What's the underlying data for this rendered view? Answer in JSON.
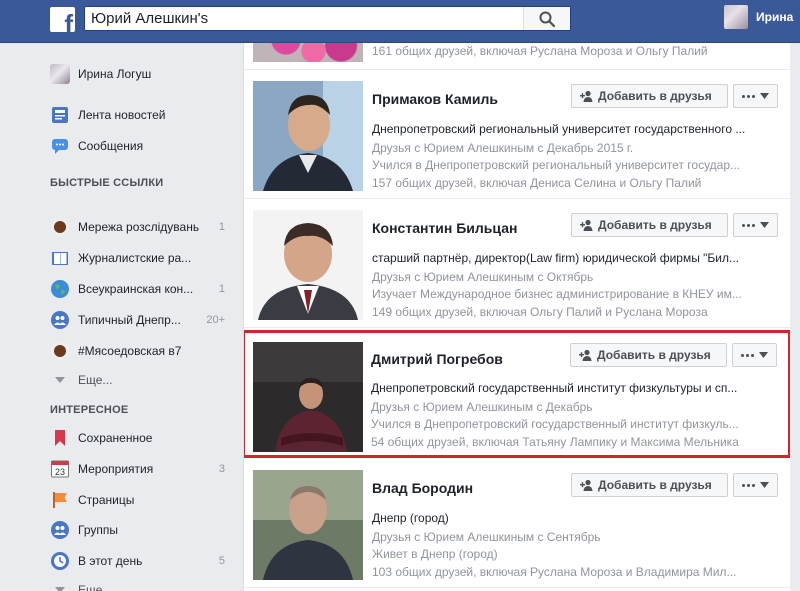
{
  "topbar": {
    "logo": "f",
    "search_value": "Юрий Алешкин's",
    "user_name": "Ирина"
  },
  "sidebar": {
    "profile_name": "Ирина Логуш",
    "news_feed": "Лента новостей",
    "messages": "Сообщения",
    "shortcuts_header": "БЫСТРЫЕ ССЫЛКИ",
    "shortcuts": [
      {
        "label": "Мережа розслідувань",
        "count": "1"
      },
      {
        "label": "Журналистские ра...",
        "count": ""
      },
      {
        "label": "Всеукраинская кон...",
        "count": "1"
      },
      {
        "label": "Типичный Днепр...",
        "count": "20+"
      },
      {
        "label": "#Мясоедовская в7",
        "count": ""
      }
    ],
    "more_label": "Еще...",
    "explore_header": "ИНТЕРЕСНОЕ",
    "explore": [
      {
        "label": "Сохраненное",
        "count": ""
      },
      {
        "label": "Мероприятия",
        "count": "3",
        "icon_text": "23"
      },
      {
        "label": "Страницы",
        "count": ""
      },
      {
        "label": "Группы",
        "count": ""
      },
      {
        "label": "В этот день",
        "count": "5"
      }
    ],
    "more2_label": "Еще..."
  },
  "partial_card": {
    "mutual": "161 общих друзей, включая Руслана Мороза и Ольгу Палий"
  },
  "labels": {
    "add_friend": "Добавить в друзья"
  },
  "cards": [
    {
      "name": "Примаков Камиль",
      "line1": "Днепропетровский региональный университет государственного ...",
      "line2": "Друзья с Юрием Алешкиным с Декабрь 2015 г.",
      "line3": "Учился в Днепропетровский региональный университет государ...",
      "line4": "157 общих друзей, включая Дениса Селина и Ольгу Палий"
    },
    {
      "name": "Константин Бильцан",
      "line1": "старший партнёр, директор(Law firm) юридической фирмы \"Бил...",
      "line2": "Друзья с Юрием Алешкиным с Октябрь",
      "line3": "Изучает Международное бизнес администрирование в КНЕУ им...",
      "line4": "149 общих друзей, включая Ольгу Палий и Руслана Мороза"
    },
    {
      "name": "Дмитрий Погребов",
      "line1": "Днепропетровский государственный институт физкультуры и сп...",
      "line2": "Друзья с Юрием Алешкиным с Декабрь",
      "line3": "Учился в Днепропетровский государственный институт физкуль...",
      "line4": "54 общих друзей, включая Татьяну Лампику и Максима Мельника"
    },
    {
      "name": "Влад Бородин",
      "line1": "Днепр (город)",
      "line2": "Друзья с Юрием Алешкиным с Сентябрь",
      "line3": "Живет в Днепр (город)",
      "line4": "103 общих друзей, включая Руслана Мороза и Владимира Мил..."
    }
  ]
}
